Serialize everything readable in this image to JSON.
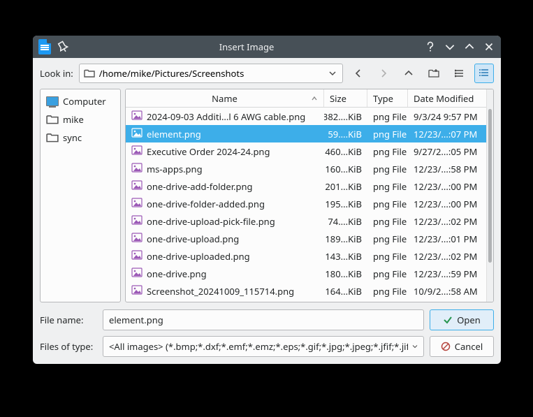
{
  "title": "Insert Image",
  "lookin_label": "Look in:",
  "path": "/home/mike/Pictures/Screenshots",
  "sidebar": {
    "items": [
      {
        "label": "Computer"
      },
      {
        "label": "mike"
      },
      {
        "label": "sync"
      }
    ]
  },
  "columns": {
    "name": "Name",
    "size": "Size",
    "type": "Type",
    "date": "Date Modified"
  },
  "files": [
    {
      "name": "2024-09-03 Additi...l 6 AWG cable.png",
      "size": "382....KiB",
      "type": "png File",
      "date": "9/3/24 9:57 PM",
      "selected": false
    },
    {
      "name": "element.png",
      "size": "59....KiB",
      "type": "png File",
      "date": "12/23/...:07 PM",
      "selected": true
    },
    {
      "name": "Executive Order 2024-24.png",
      "size": "460...KiB",
      "type": "png File",
      "date": "9/27/2...:05 PM",
      "selected": false
    },
    {
      "name": "ms-apps.png",
      "size": "160...KiB",
      "type": "png File",
      "date": "12/23/...:58 PM",
      "selected": false
    },
    {
      "name": "one-drive-add-folder.png",
      "size": "201...KiB",
      "type": "png File",
      "date": "12/23/...:00 PM",
      "selected": false
    },
    {
      "name": "one-drive-folder-added.png",
      "size": "195...KiB",
      "type": "png File",
      "date": "12/23/...:00 PM",
      "selected": false
    },
    {
      "name": "one-drive-upload-pick-file.png",
      "size": "74....KiB",
      "type": "png File",
      "date": "12/23/...:02 PM",
      "selected": false
    },
    {
      "name": "one-drive-upload.png",
      "size": "189...KiB",
      "type": "png File",
      "date": "12/23/...:01 PM",
      "selected": false
    },
    {
      "name": "one-drive-uploaded.png",
      "size": "143...KiB",
      "type": "png File",
      "date": "12/23/...:02 PM",
      "selected": false
    },
    {
      "name": "one-drive.png",
      "size": "180...KiB",
      "type": "png File",
      "date": "12/23/...:59 PM",
      "selected": false
    },
    {
      "name": "Screenshot_20241009_115714.png",
      "size": "164...KiB",
      "type": "png File",
      "date": "10/9/2...:58 AM",
      "selected": false
    }
  ],
  "filename_label": "File name:",
  "filename_value": "element.png",
  "filetype_label": "Files of type:",
  "filetype_value": "<All images> (*.bmp;*.dxf;*.emf;*.emz;*.eps;*.gif;*.jpg;*.jpeg;*.jfif;*.jif;*.n",
  "open_label": "Open",
  "cancel_label": "Cancel"
}
